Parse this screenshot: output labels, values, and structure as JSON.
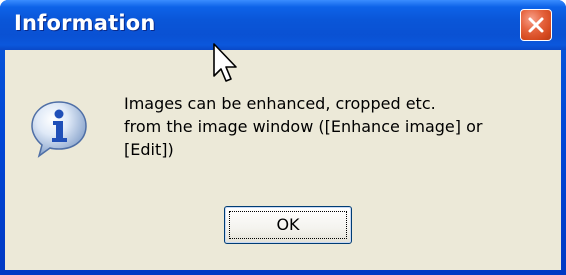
{
  "window": {
    "title": "Information",
    "close_icon": "close-x-icon"
  },
  "dialog": {
    "icon": "information-icon",
    "message_lines": [
      "Images can be enhanced, cropped etc.",
      "from the image window ([Enhance image] or",
      "[Edit])"
    ],
    "ok_label": "OK"
  },
  "colors": {
    "titlebar": "#0a56d8",
    "client_background": "#ece9d8",
    "close_button": "#d4481e",
    "button_border": "#003c74"
  },
  "cursor": {
    "icon": "mouse-pointer-icon"
  }
}
